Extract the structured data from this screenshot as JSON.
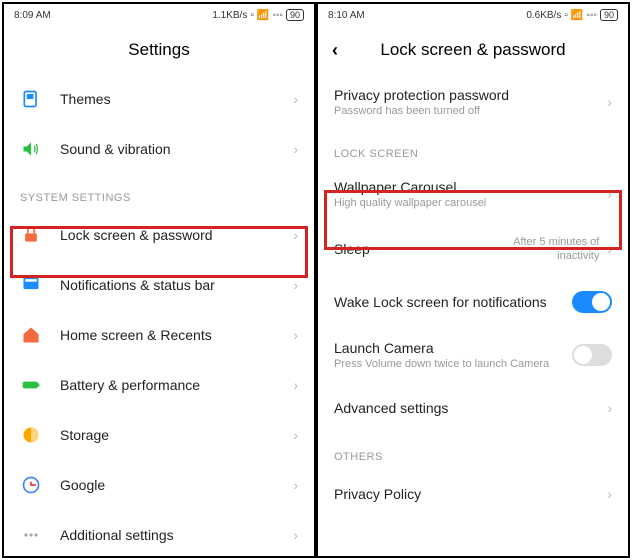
{
  "left": {
    "statusbar": {
      "time": "8:09 AM",
      "speed": "1.1KB/s",
      "battery": "90"
    },
    "header": {
      "title": "Settings"
    },
    "rows": {
      "themes": "Themes",
      "sound": "Sound & vibration"
    },
    "section_system": "SYSTEM SETTINGS",
    "system": {
      "lockscreen": "Lock screen & password",
      "notifications": "Notifications & status bar",
      "home": "Home screen & Recents",
      "battery": "Battery & performance",
      "storage": "Storage",
      "google": "Google",
      "additional": "Additional settings"
    }
  },
  "right": {
    "statusbar": {
      "time": "8:10 AM",
      "speed": "0.6KB/s",
      "battery": "90"
    },
    "header": {
      "title": "Lock screen & password"
    },
    "privacy": {
      "label": "Privacy protection password",
      "sub": "Password has been turned off"
    },
    "section_lock": "LOCK SCREEN",
    "carousel": {
      "label": "Wallpaper Carousel",
      "sub": "High quality wallpaper carousel"
    },
    "sleep": {
      "label": "Sleep",
      "value": "After 5 minutes of inactivity"
    },
    "wake": {
      "label": "Wake Lock screen for notifications"
    },
    "camera": {
      "label": "Launch Camera",
      "sub": "Press Volume down twice to launch Camera"
    },
    "advanced": {
      "label": "Advanced settings"
    },
    "section_others": "OTHERS",
    "privacy_policy": {
      "label": "Privacy Policy"
    }
  }
}
